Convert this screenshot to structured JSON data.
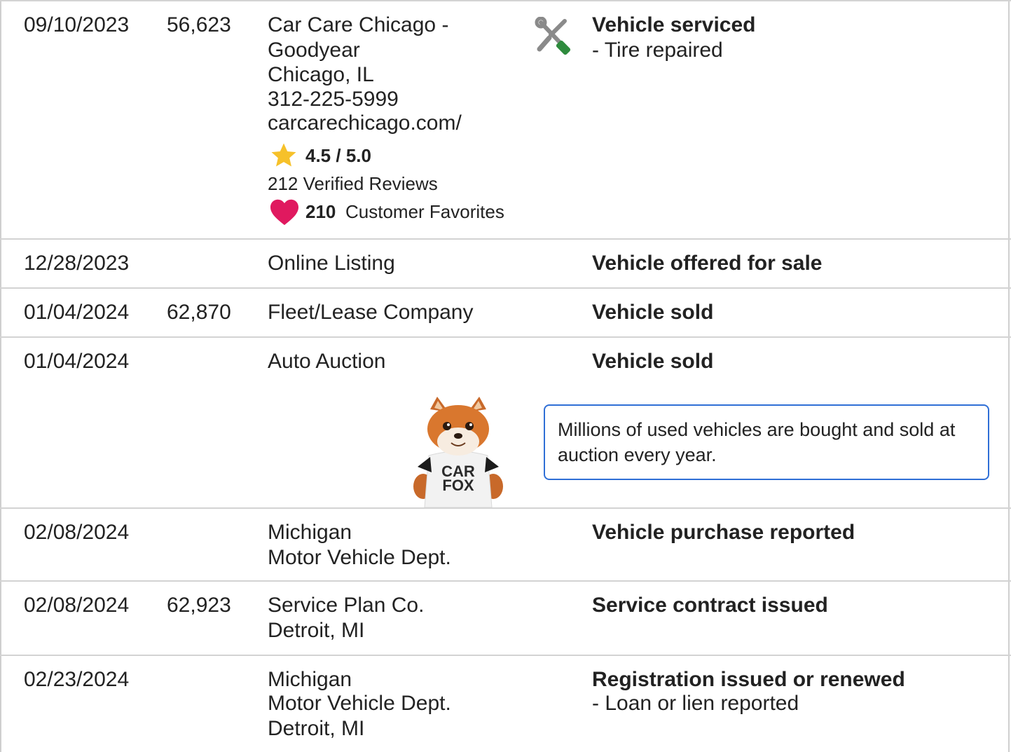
{
  "rows": [
    {
      "date": "09/10/2023",
      "mileage": "56,623",
      "source": [
        "Car Care Chicago -",
        "Goodyear",
        "Chicago, IL",
        "312-225-5999",
        "carcarechicago.com/"
      ],
      "rating": "4.5 / 5.0",
      "reviews": "212 Verified Reviews",
      "favorites_count": "210",
      "favorites_label": "Customer Favorites",
      "event_title": "Vehicle serviced",
      "event_details": [
        "- Tire repaired"
      ],
      "icon": "wrench-screwdriver-icon"
    },
    {
      "date": "12/28/2023",
      "mileage": "",
      "source": [
        "Online Listing"
      ],
      "event_title": "Vehicle offered for sale",
      "event_details": []
    },
    {
      "date": "01/04/2024",
      "mileage": "62,870",
      "source": [
        "Fleet/Lease Company"
      ],
      "event_title": "Vehicle sold",
      "event_details": []
    },
    {
      "date": "01/04/2024",
      "mileage": "",
      "source": [
        "Auto Auction"
      ],
      "event_title": "Vehicle sold",
      "event_details": []
    },
    {
      "date": "02/08/2024",
      "mileage": "",
      "source": [
        "Michigan",
        "Motor Vehicle Dept."
      ],
      "event_title": "Vehicle purchase reported",
      "event_details": []
    },
    {
      "date": "02/08/2024",
      "mileage": "62,923",
      "source": [
        "Service Plan Co.",
        "Detroit, MI"
      ],
      "event_title": "Service contract issued",
      "event_details": []
    },
    {
      "date": "02/23/2024",
      "mileage": "",
      "source": [
        "Michigan",
        "Motor Vehicle Dept.",
        "Detroit, MI"
      ],
      "event_title": "Registration issued or renewed",
      "event_details": [
        "- Loan or lien reported"
      ]
    }
  ],
  "mascot": {
    "shirt_line1": "CAR",
    "shirt_line2": "FOX"
  },
  "callout": {
    "text": "Millions of used vehicles are bought and sold at auction every year."
  },
  "colors": {
    "star": "#f6c12a",
    "heart": "#e0195f",
    "callout_border": "#2f6fd6",
    "divider": "#d3d3d3",
    "tool_green": "#2e8b3d",
    "tool_gray": "#8a8a8a"
  }
}
